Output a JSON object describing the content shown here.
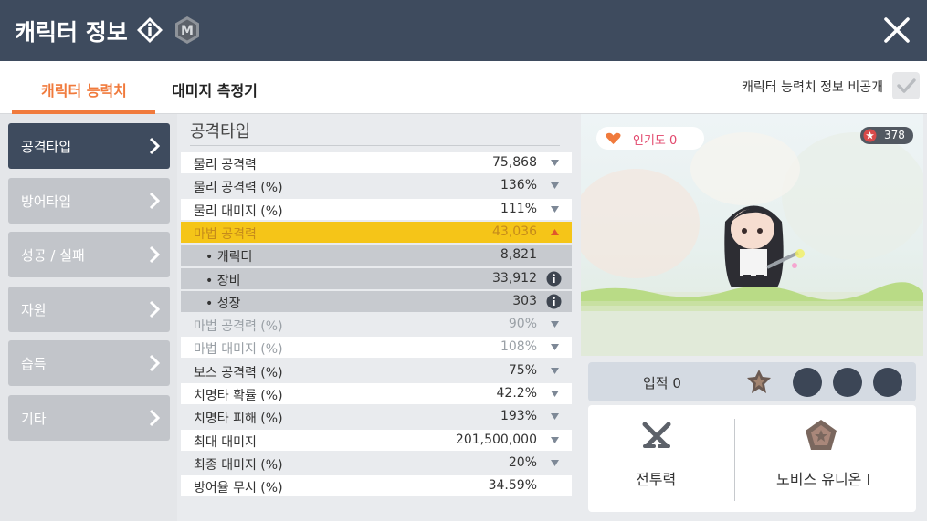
{
  "header": {
    "title": "캐릭터 정보",
    "close_icon": "close-icon",
    "info_badge_icon": "info-diamond-icon",
    "m_badge_label": "M"
  },
  "tabs": [
    {
      "label": "캐릭터 능력치",
      "active": true
    },
    {
      "label": "대미지 측정기",
      "active": false
    }
  ],
  "privacy": {
    "label": "캐릭터 능력치 정보 비공개",
    "checked": true
  },
  "sidebar": {
    "items": [
      {
        "label": "공격타입",
        "active": true
      },
      {
        "label": "방어타입",
        "active": false
      },
      {
        "label": "성공 / 실패",
        "active": false
      },
      {
        "label": "자원",
        "active": false
      },
      {
        "label": "습득",
        "active": false
      },
      {
        "label": "기타",
        "active": false
      }
    ]
  },
  "stats": {
    "section_title": "공격타입",
    "rows": [
      {
        "name": "물리 공격력",
        "value": "75,868",
        "kind": "even",
        "arrow": "down"
      },
      {
        "name": "물리 공격력 (%)",
        "value": "136%",
        "kind": "odd",
        "arrow": "down"
      },
      {
        "name": "물리 대미지 (%)",
        "value": "111%",
        "kind": "even",
        "arrow": "down"
      },
      {
        "name": "마법 공격력",
        "value": "43,036",
        "kind": "highlight",
        "arrow": "up"
      },
      {
        "name": "• 캐릭터",
        "value": "8,821",
        "kind": "sub",
        "arrow": ""
      },
      {
        "name": "• 장비",
        "value": "33,912",
        "kind": "sub",
        "arrow": "info"
      },
      {
        "name": "• 성장",
        "value": "303",
        "kind": "sub",
        "arrow": "info"
      },
      {
        "name": "마법 공격력 (%)",
        "value": "90%",
        "kind": "odd dim",
        "arrow": "down"
      },
      {
        "name": "마법 대미지 (%)",
        "value": "108%",
        "kind": "even dim",
        "arrow": "down"
      },
      {
        "name": "보스 공격력 (%)",
        "value": "75%",
        "kind": "odd",
        "arrow": "down"
      },
      {
        "name": "치명타 확률 (%)",
        "value": "42.2%",
        "kind": "even",
        "arrow": "down"
      },
      {
        "name": "치명타 피해 (%)",
        "value": "193%",
        "kind": "odd",
        "arrow": "down"
      },
      {
        "name": "최대 대미지",
        "value": "201,500,000",
        "kind": "even",
        "arrow": "down"
      },
      {
        "name": "최종 대미지 (%)",
        "value": "20%",
        "kind": "odd",
        "arrow": "down"
      },
      {
        "name": "방어율 무시 (%)",
        "value": "34.59%",
        "kind": "even",
        "arrow": ""
      }
    ]
  },
  "character": {
    "popularity_label": "인기도 0",
    "level": "378"
  },
  "achievement": {
    "label": "업적 0"
  },
  "bottom": {
    "combat_label": "전투력",
    "union_label": "노비스 유니온 I"
  },
  "colors": {
    "header_bg": "#3e4b5e",
    "accent": "#f07a3c",
    "highlight_row": "#f5c518"
  }
}
